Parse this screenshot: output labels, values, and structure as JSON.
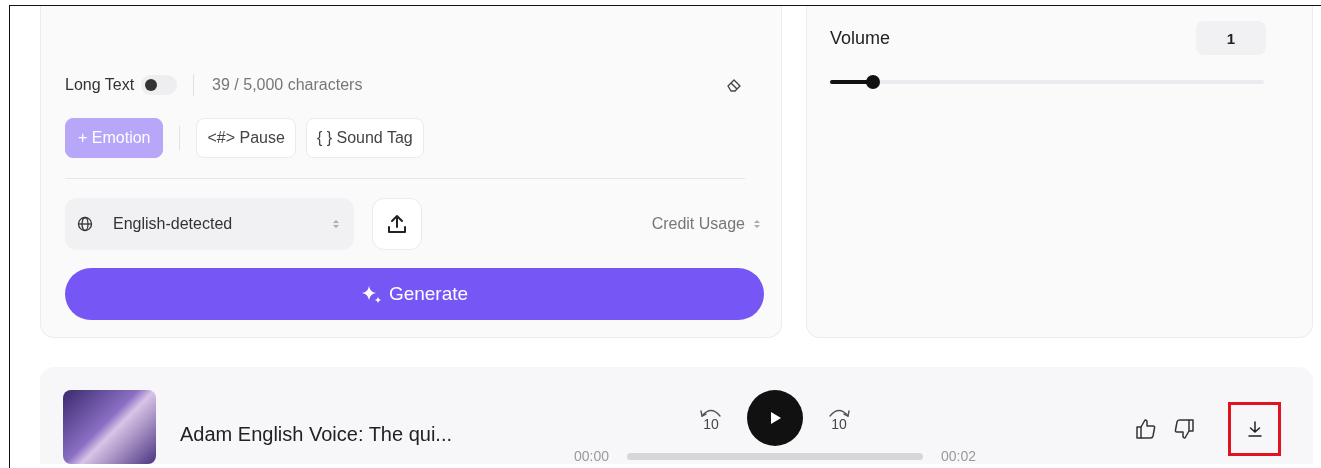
{
  "editor": {
    "long_text": {
      "label": "Long Text",
      "on": false
    },
    "char_count": "39 / 5,000 characters",
    "tags": [
      {
        "label": "+ Emotion",
        "kind": "primary"
      },
      {
        "label": "<#> Pause",
        "kind": "outline"
      },
      {
        "label": "{ } Sound Tag",
        "kind": "outline"
      }
    ],
    "language": "English-detected",
    "credit_usage": "Credit Usage",
    "generate": "Generate"
  },
  "settings": {
    "volume": {
      "label": "Volume",
      "value": "1",
      "level": 0.1
    }
  },
  "player": {
    "title": "Adam English Voice: The qui...",
    "rewind": "10",
    "forward": "10",
    "current_time": "00:00",
    "duration": "00:02",
    "progress": {
      "level": 0
    },
    "download": {
      "highlighted": true
    }
  }
}
